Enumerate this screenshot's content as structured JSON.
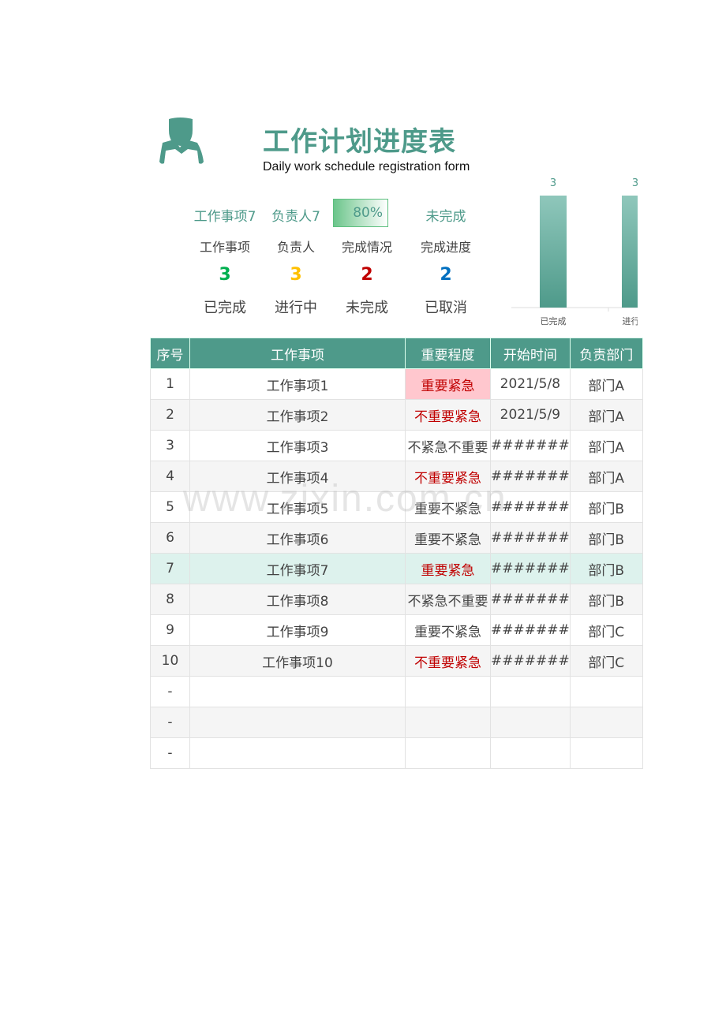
{
  "header": {
    "title": "工作计划进度表",
    "subtitle": "Daily work schedule registration form",
    "icon": "person-icon"
  },
  "summary": {
    "selected": {
      "item": "工作事项7",
      "owner": "负责人7",
      "completion": "80%",
      "completion_value": 80,
      "progress": "未完成"
    },
    "labels": [
      "工作事项",
      "负责人",
      "完成情况",
      "完成进度"
    ],
    "counts": [
      {
        "value": "3",
        "label": "已完成",
        "color": "#00b050"
      },
      {
        "value": "3",
        "label": "进行中",
        "color": "#ffc000"
      },
      {
        "value": "2",
        "label": "未完成",
        "color": "#c00000"
      },
      {
        "value": "2",
        "label": "已取消",
        "color": "#0070c0"
      }
    ]
  },
  "chart_data": {
    "type": "bar",
    "categories": [
      "已完成",
      "进行中"
    ],
    "values": [
      3,
      3
    ],
    "color": "#4e9a8a"
  },
  "table": {
    "headers": [
      "序号",
      "工作事项",
      "重要程度",
      "开始时间",
      "负责部门"
    ],
    "rows": [
      [
        "1",
        "工作事项1",
        "重要紧急",
        "2021/5/8",
        "部门A"
      ],
      [
        "2",
        "工作事项2",
        "不重要紧急",
        "2021/5/9",
        "部门A"
      ],
      [
        "3",
        "工作事项3",
        "不紧急不重要",
        "#######",
        "部门A"
      ],
      [
        "4",
        "工作事项4",
        "不重要紧急",
        "#######",
        "部门A"
      ],
      [
        "5",
        "工作事项5",
        "重要不紧急",
        "#######",
        "部门B"
      ],
      [
        "6",
        "工作事项6",
        "重要不紧急",
        "#######",
        "部门B"
      ],
      [
        "7",
        "工作事项7",
        "重要紧急",
        "#######",
        "部门B"
      ],
      [
        "8",
        "工作事项8",
        "不紧急不重要",
        "#######",
        "部门B"
      ],
      [
        "9",
        "工作事项9",
        "重要不紧急",
        "#######",
        "部门C"
      ],
      [
        "10",
        "工作事项10",
        "不重要紧急",
        "#######",
        "部门C"
      ],
      [
        "-",
        "",
        "",
        "",
        ""
      ],
      [
        "-",
        "",
        "",
        "",
        ""
      ],
      [
        "-",
        "",
        "",
        "",
        ""
      ]
    ]
  },
  "watermark": "www.zixin.com.cn"
}
